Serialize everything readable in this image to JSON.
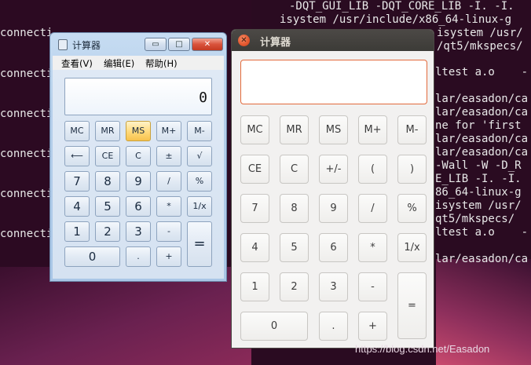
{
  "terminal_left": {
    "lines": [
      "connecti",
      "connecti",
      "connecti",
      "connecti",
      "connecti",
      "connecti"
    ]
  },
  "terminal_right": {
    "lines": [
      "-DQT_GUI_LIB -DQT_CORE_LIB -I. -I.",
      "isystem /usr/include/x86_64-linux-g",
      "isystem /usr/",
      "/qt5/mkspecs/",
      "ltest a.o    -",
      "lar/easadon/ca",
      "lar/easadon/ca",
      "ne for 'first",
      "lar/easadon/ca",
      "lar/easadon/ca",
      "-Wall -W -D_R",
      "E_LIB -I. -I.",
      "86_64-linux-g",
      "isystem /usr/",
      "qt5/mkspecs/",
      "ltest a.o    -",
      "lar/easadon/ca"
    ]
  },
  "win7_calc": {
    "title": "计算器",
    "window_buttons": {
      "minimize": "▭",
      "maximize": "□",
      "close": "✕"
    },
    "menu": [
      "查看(V)",
      "编辑(E)",
      "帮助(H)"
    ],
    "display_value": "0",
    "keys": [
      "MC",
      "MR",
      "MS",
      "M+",
      "M-",
      "⟵",
      "CE",
      "C",
      "±",
      "√",
      "7",
      "8",
      "9",
      "/",
      "%",
      "4",
      "5",
      "6",
      "*",
      "1/x",
      "1",
      "2",
      "3",
      "-",
      "=",
      "0",
      ".",
      "+"
    ]
  },
  "qt_calc": {
    "title": "计算器",
    "close_glyph": "✕",
    "display_value": "",
    "keys": [
      "MC",
      "MR",
      "MS",
      "M+",
      "M-",
      "CE",
      "C",
      "+/-",
      "(",
      ")",
      "7",
      "8",
      "9",
      "/",
      "%",
      "4",
      "5",
      "6",
      "*",
      "1/x",
      "1",
      "2",
      "3",
      "-",
      "=",
      "0",
      ".",
      "+"
    ]
  },
  "watermark": "https://blog.csdn.net/Easadon"
}
